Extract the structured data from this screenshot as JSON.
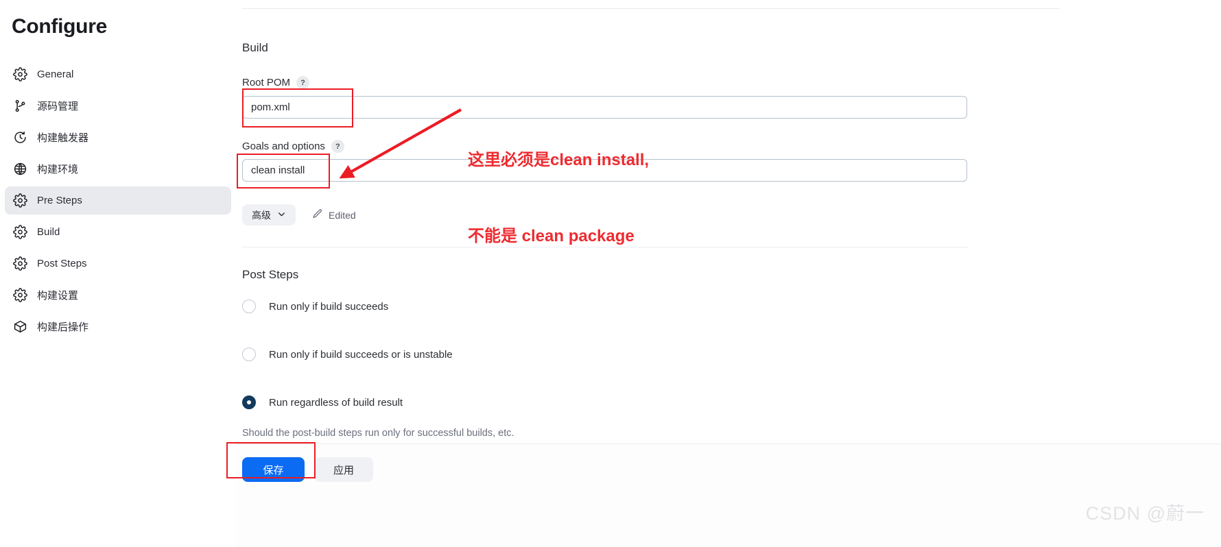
{
  "sidebar": {
    "title": "Configure",
    "items": [
      {
        "label": "General",
        "icon": "gear-icon",
        "active": false
      },
      {
        "label": "源码管理",
        "icon": "branch-icon",
        "active": false
      },
      {
        "label": "构建触发器",
        "icon": "clock-icon",
        "active": false
      },
      {
        "label": "构建环境",
        "icon": "globe-icon",
        "active": false
      },
      {
        "label": "Pre Steps",
        "icon": "gear-icon",
        "active": true
      },
      {
        "label": "Build",
        "icon": "gear-icon",
        "active": false
      },
      {
        "label": "Post Steps",
        "icon": "gear-icon",
        "active": false
      },
      {
        "label": "构建设置",
        "icon": "gear-icon",
        "active": false
      },
      {
        "label": "构建后操作",
        "icon": "package-icon",
        "active": false
      }
    ]
  },
  "build": {
    "section_title": "Build",
    "root_pom": {
      "label": "Root POM",
      "help": "?",
      "value": "pom.xml"
    },
    "goals": {
      "label": "Goals and options",
      "help": "?",
      "value": "clean install"
    },
    "advanced_button": "高级",
    "advanced_caret": "chevron-down-icon",
    "edited_label": "Edited",
    "edited_icon": "pencil-icon"
  },
  "post_steps": {
    "section_title": "Post Steps",
    "options": [
      {
        "label": "Run only if build succeeds",
        "checked": false
      },
      {
        "label": "Run only if build succeeds or is unstable",
        "checked": false
      },
      {
        "label": "Run regardless of build result",
        "checked": true
      }
    ],
    "hint": "Should the post-build steps run only for successful builds, etc."
  },
  "actions": {
    "save_label": "保存",
    "apply_label": "应用"
  },
  "annotation": {
    "line1": "这里必须是clean install,",
    "line2": "不能是 clean package",
    "color": "#ee2b30"
  },
  "watermark": "CSDN @蔚一",
  "colors": {
    "accent_blue": "#0b6bf2",
    "radio_checked": "#123a5e",
    "annotation_red": "#ec1c24",
    "sidebar_active_bg": "#e9eaee",
    "input_border": "#b6c2cb"
  }
}
